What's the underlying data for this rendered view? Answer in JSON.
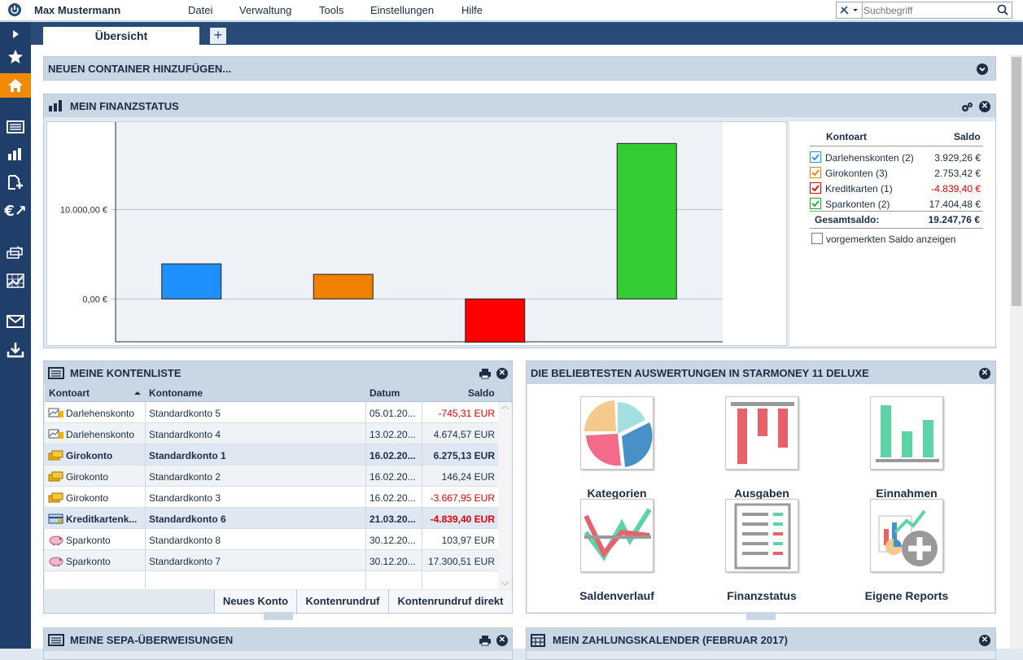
{
  "topbar": {
    "user": "Max Mustermann",
    "menu": [
      "Datei",
      "Verwaltung",
      "Tools",
      "Einstellungen",
      "Hilfe"
    ],
    "search_placeholder": "Suchbegriff"
  },
  "sidebar": {
    "icons": [
      "expand-arrow-icon",
      "star-icon",
      "home-icon",
      "list-icon",
      "bar-chart-icon",
      "add-document-icon",
      "euro-transfer-icon",
      "money-stack-icon",
      "chart-grid-icon",
      "mail-icon",
      "download-icon"
    ]
  },
  "tabs": {
    "active": "Übersicht",
    "add": "+"
  },
  "container_panel": {
    "title": "NEUEN CONTAINER HINZUFÜGEN..."
  },
  "finanz": {
    "title": "MEIN FINANZSTATUS",
    "legend": {
      "col_type": "Kontoart",
      "col_saldo": "Saldo",
      "rows": [
        {
          "name": "Darlehenskonten (2)",
          "value": "3.929,26 €",
          "color": "#1e90ff",
          "check": "#1e90ff"
        },
        {
          "name": "Girokonten (3)",
          "value": "2.753,42 €",
          "color": "#f08000",
          "check": "#f08000"
        },
        {
          "name": "Kreditkarten (1)",
          "value": "-4.839,40 €",
          "color": "#ff0000",
          "check": "#e00000"
        },
        {
          "name": "Sparkonten (2)",
          "value": "17.404,48 €",
          "color": "#33cc33",
          "check": "#22aa22"
        }
      ],
      "total_label": "Gesamtsaldo:",
      "total_value": "19.247,76 €",
      "pending_label": "vorgemerkten Saldo anzeigen"
    }
  },
  "chart_data": {
    "type": "bar",
    "categories": [
      "Darlehenskonten",
      "Girokonten",
      "Kreditkarten",
      "Sparkonten"
    ],
    "values": [
      3929.26,
      2753.42,
      -4839.4,
      17404.48
    ],
    "colors": [
      "#1e90ff",
      "#f08000",
      "#ff0000",
      "#33cc33"
    ],
    "yticks": [
      "10.000,00 €",
      "0,00 €"
    ],
    "ylim": [
      -4800,
      19800
    ],
    "grid": true
  },
  "kontenliste": {
    "title": "MEINE KONTENLISTE",
    "columns": [
      "Kontoart",
      "Kontoname",
      "Datum",
      "Saldo"
    ],
    "rows": [
      {
        "type": "Darlehenskonto",
        "name": "Standardkonto 5",
        "date": "05.01.20...",
        "saldo": "-745,31 EUR",
        "neg": true,
        "icon": "loan-icon"
      },
      {
        "type": "Darlehenskonto",
        "name": "Standardkonto 4",
        "date": "13.02.20...",
        "saldo": "4.674,57 EUR",
        "neg": false,
        "icon": "loan-icon"
      },
      {
        "type": "Girokonto",
        "name": "Standardkonto 1",
        "date": "16.02.20...",
        "saldo": "6.275,13 EUR",
        "neg": false,
        "icon": "coins-icon",
        "sel": true
      },
      {
        "type": "Girokonto",
        "name": "Standardkonto 2",
        "date": "16.02.20...",
        "saldo": "146,24 EUR",
        "neg": false,
        "icon": "coins-icon"
      },
      {
        "type": "Girokonto",
        "name": "Standardkonto 3",
        "date": "16.02.20...",
        "saldo": "-3.667,95 EUR",
        "neg": true,
        "icon": "coins-icon"
      },
      {
        "type": "Kreditkartenk...",
        "name": "Standardkonto 6",
        "date": "21.03.20...",
        "saldo": "-4.839,40 EUR",
        "neg": true,
        "icon": "credit-card-icon",
        "sel": true
      },
      {
        "type": "Sparkonto",
        "name": "Standardkonto 8",
        "date": "30.12.20...",
        "saldo": "103,97 EUR",
        "neg": false,
        "icon": "piggy-bank-icon"
      },
      {
        "type": "Sparkonto",
        "name": "Standardkonto 7",
        "date": "30.12.20...",
        "saldo": "17.300,51 EUR",
        "neg": false,
        "icon": "piggy-bank-icon"
      }
    ],
    "buttons": [
      "Neues Konto",
      "Kontenrundruf",
      "Kontenrundruf direkt"
    ]
  },
  "auswertungen": {
    "title": "DIE BELIEBTESTEN AUSWERTUNGEN IN STARMONEY 11 DELUXE",
    "tiles": [
      "Kategorien",
      "Ausgaben",
      "Einnahmen",
      "Saldenverlauf",
      "Finanzstatus",
      "Eigene Reports"
    ]
  },
  "sepa": {
    "title": "MEINE SEPA-ÜBERWEISUNGEN"
  },
  "kalender": {
    "title": "MEIN ZAHLUNGSKALENDER (FEBRUAR 2017)"
  }
}
